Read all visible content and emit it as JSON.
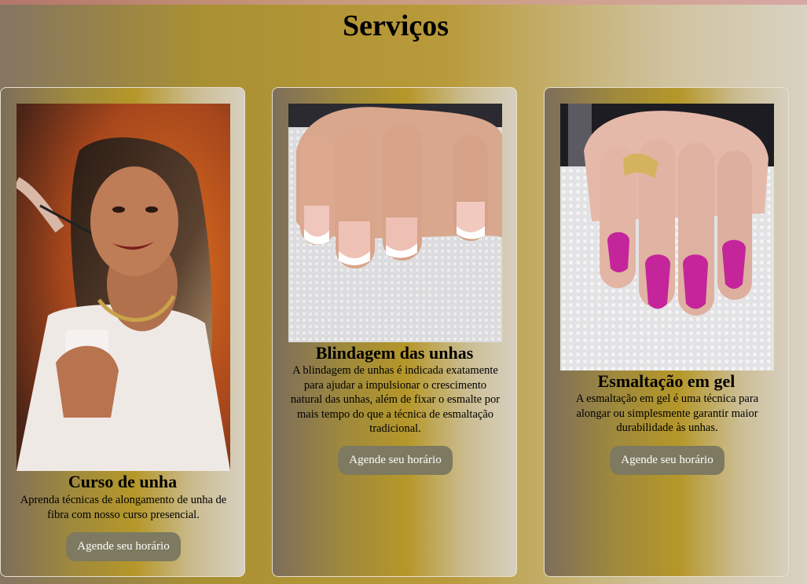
{
  "page": {
    "title": "Serviços"
  },
  "services": [
    {
      "title": "Curso de unha",
      "description": "Aprenda técnicas de alongamento de unha de fibra com nosso curso presencial.",
      "button": "Agende seu horário",
      "image": "woman-applying-nail-product-photo"
    },
    {
      "title": "Blindagem das unhas",
      "description": "A blindagem de unhas é indicada exatamente para ajudar a impulsionar o crescimento natural das unhas, além de fixar o esmalte por mais tempo do que a técnica de esmaltação tradicional.",
      "button": "Agende seu horário",
      "image": "french-manicure-nails-photo"
    },
    {
      "title": "Esmaltação em gel",
      "description": "A esmaltação em gel é uma técnica para alongar ou simplesmente garantir maior durabilidade às unhas.",
      "button": "Agende seu horário",
      "image": "magenta-gel-nails-photo"
    }
  ],
  "colors": {
    "button_bg": "#7e7a61",
    "button_text": "#ffffff",
    "gel_polish": "#c4259a"
  }
}
